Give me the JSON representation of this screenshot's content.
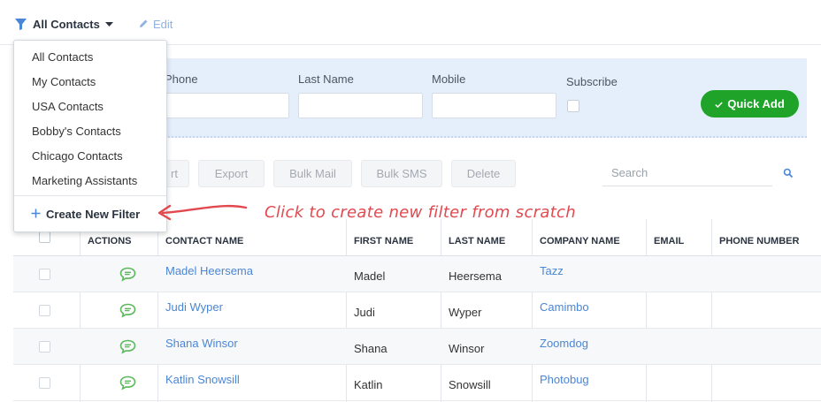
{
  "header": {
    "filter_label": "All Contacts",
    "edit_label": "Edit"
  },
  "quick_add": {
    "fields": [
      {
        "label": "Phone"
      },
      {
        "label": "Last Name"
      },
      {
        "label": "Mobile"
      }
    ],
    "subscribe_label": "Subscribe",
    "button_label": "Quick Add"
  },
  "toolbar": {
    "import_label": "rt",
    "export_label": "Export",
    "bulk_mail_label": "Bulk Mail",
    "bulk_sms_label": "Bulk SMS",
    "delete_label": "Delete",
    "search_placeholder": "Search"
  },
  "table": {
    "columns": [
      "ACTIONS",
      "CONTACT NAME",
      "FIRST NAME",
      "LAST NAME",
      "COMPANY NAME",
      "EMAIL",
      "PHONE NUMBER"
    ],
    "rows": [
      {
        "contact": "Madel Heersema",
        "first": "Madel",
        "last": "Heersema",
        "company": "Tazz"
      },
      {
        "contact": "Judi Wyper",
        "first": "Judi",
        "last": "Wyper",
        "company": "Camimbo"
      },
      {
        "contact": "Shana Winsor",
        "first": "Shana",
        "last": "Winsor",
        "company": "Zoomdog"
      },
      {
        "contact": "Katlin Snowsill",
        "first": "Katlin",
        "last": "Snowsill",
        "company": "Photobug"
      }
    ]
  },
  "dropdown": {
    "items": [
      "All Contacts",
      "My Contacts",
      "USA Contacts",
      "Bobby's Contacts",
      "Chicago Contacts",
      "Marketing Assistants"
    ],
    "create_label": "Create New Filter"
  },
  "annotation": {
    "text": "Click to create new filter from scratch"
  },
  "colors": {
    "accent": "#4a86d6",
    "quick_add": "#1fa429",
    "annotation": "#e2494f",
    "chat_icon": "#5cb85c"
  },
  "icons": [
    "filter-icon",
    "caret-down-icon",
    "pencil-icon",
    "check-icon",
    "search-icon",
    "chat-icon",
    "plus-icon",
    "arrow-icon"
  ]
}
